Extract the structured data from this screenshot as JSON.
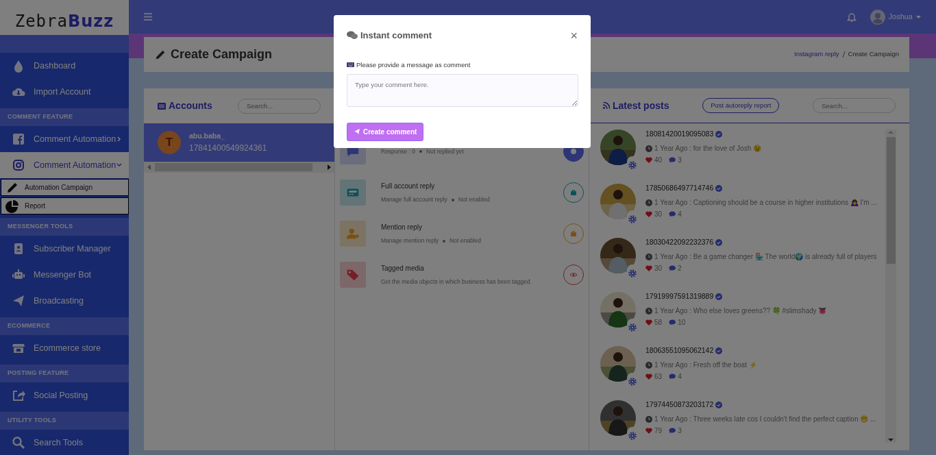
{
  "brand": {
    "first": "Zebra",
    "second": "Buzz"
  },
  "sidebar": [
    {
      "items": [
        {
          "label": "Dashboard",
          "selected": false
        },
        {
          "label": "Import Account",
          "selected": false
        }
      ]
    },
    {
      "heading": "COMMENT FEATURE",
      "items": [
        {
          "label": "Comment Automation",
          "selected": false,
          "expanded": false
        },
        {
          "label": "Comment Automation",
          "selected": true,
          "expanded": true,
          "children": [
            {
              "label": "Automation Campaign"
            },
            {
              "label": "Report"
            }
          ]
        }
      ]
    },
    {
      "heading": "MESSENGER TOOLS",
      "items": [
        {
          "label": "Subscriber Manager",
          "selected": false
        },
        {
          "label": "Messenger Bot",
          "selected": false
        },
        {
          "label": "Broadcasting",
          "selected": false
        }
      ]
    },
    {
      "heading": "ECOMMERCE",
      "items": [
        {
          "label": "Ecommerce store",
          "selected": false
        }
      ]
    },
    {
      "heading": "POSTING FEATURE",
      "items": [
        {
          "label": "Social Posting",
          "selected": false
        }
      ]
    },
    {
      "heading": "UTILITY TOOLS",
      "items": [
        {
          "label": "Search Tools",
          "selected": false
        }
      ]
    }
  ],
  "topbar": {
    "user": "Joshua"
  },
  "page_header": {
    "title": "Create Campaign",
    "breadcrumb": [
      {
        "label": "Instagram reply",
        "active": false
      },
      {
        "label": "Create Campaign",
        "active": true
      }
    ]
  },
  "accounts": {
    "title": "Accounts",
    "search_placeholder": "Search...",
    "items": [
      {
        "initial": "T",
        "name": "abu.baba_",
        "id": "17841400549924361",
        "selected": true
      }
    ]
  },
  "features": [
    {
      "subtitle": "Response : 0",
      "status": "Not replied yet"
    },
    {
      "title": "Full account reply",
      "subtitle": "Manage full account reply",
      "status": "Not enabled"
    },
    {
      "title": "Mention reply",
      "subtitle": "Manage mention reply",
      "status": "Not enabled"
    },
    {
      "title": "Tagged media",
      "subtitle": "Get the media objects in which business has been tagged."
    }
  ],
  "posts": {
    "title": "Latest posts",
    "report_button": "Post autoreply report",
    "search_placeholder": "Search...",
    "items": [
      {
        "id": "18081420019095083",
        "meta": "1 Year Ago : for the love of Josh 😉",
        "likes": "40",
        "comments": "3"
      },
      {
        "id": "17850686497714746",
        "meta": "1 Year Ago : Captioning should be a course in higher institutions 🙇‍♀️ I'm ...",
        "likes": "30",
        "comments": "4"
      },
      {
        "id": "18030422092232376",
        "meta": "1 Year Ago : Be a game changer 🏪 The world🌍 is already full of players",
        "likes": "30",
        "comments": "2"
      },
      {
        "id": "17919997591319889",
        "meta": "1 Year Ago : Who else loves greens?? 🍀 #slimshady 👅",
        "likes": "58",
        "comments": "10"
      },
      {
        "id": "18063551095062142",
        "meta": "1 Year Ago : Fresh off the boat ⚡",
        "likes": "63",
        "comments": "4"
      },
      {
        "id": "17974450873203172",
        "meta": "1 Year Ago : Three weeks late cos I couldn't find the perfect caption 😬 ...",
        "likes": "79",
        "comments": "3"
      }
    ]
  },
  "modal": {
    "title": "Instant comment",
    "close": "×",
    "label": "Please provide a message as comment",
    "placeholder": "Type your comment here.",
    "button": "Create comment"
  }
}
